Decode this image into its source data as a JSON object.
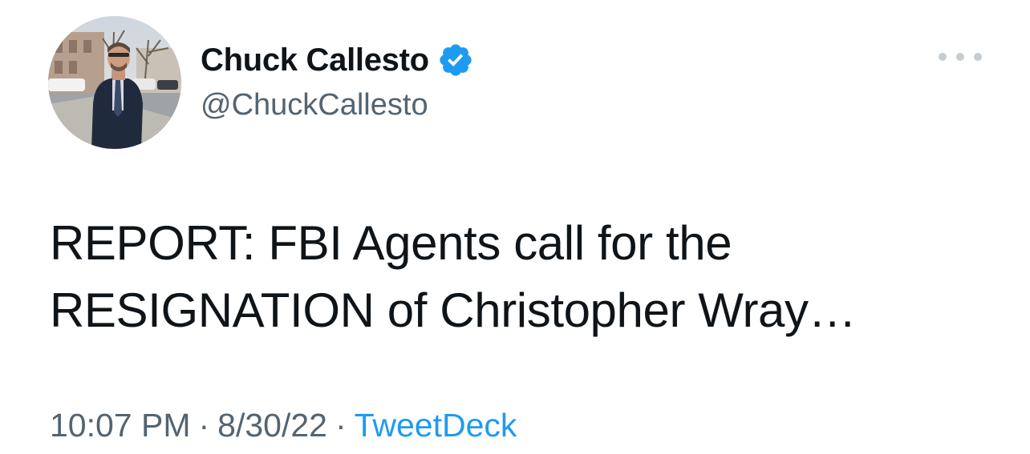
{
  "author": {
    "display_name": "Chuck Callesto",
    "handle": "@ChuckCallesto",
    "verified": true,
    "avatar_icon": "profile-photo",
    "verified_icon": "verified-badge-icon"
  },
  "menu": {
    "icon": "more-options-icon"
  },
  "tweet": {
    "lines": [
      "REPORT: FBI Agents call for the",
      "RESIGNATION of Christopher Wray…"
    ]
  },
  "meta": {
    "time": "10:07 PM",
    "separator": "·",
    "date": "8/30/22",
    "source": "TweetDeck"
  },
  "colors": {
    "text": "#0f1419",
    "secondary": "#536471",
    "accent": "#1d9bf0"
  }
}
